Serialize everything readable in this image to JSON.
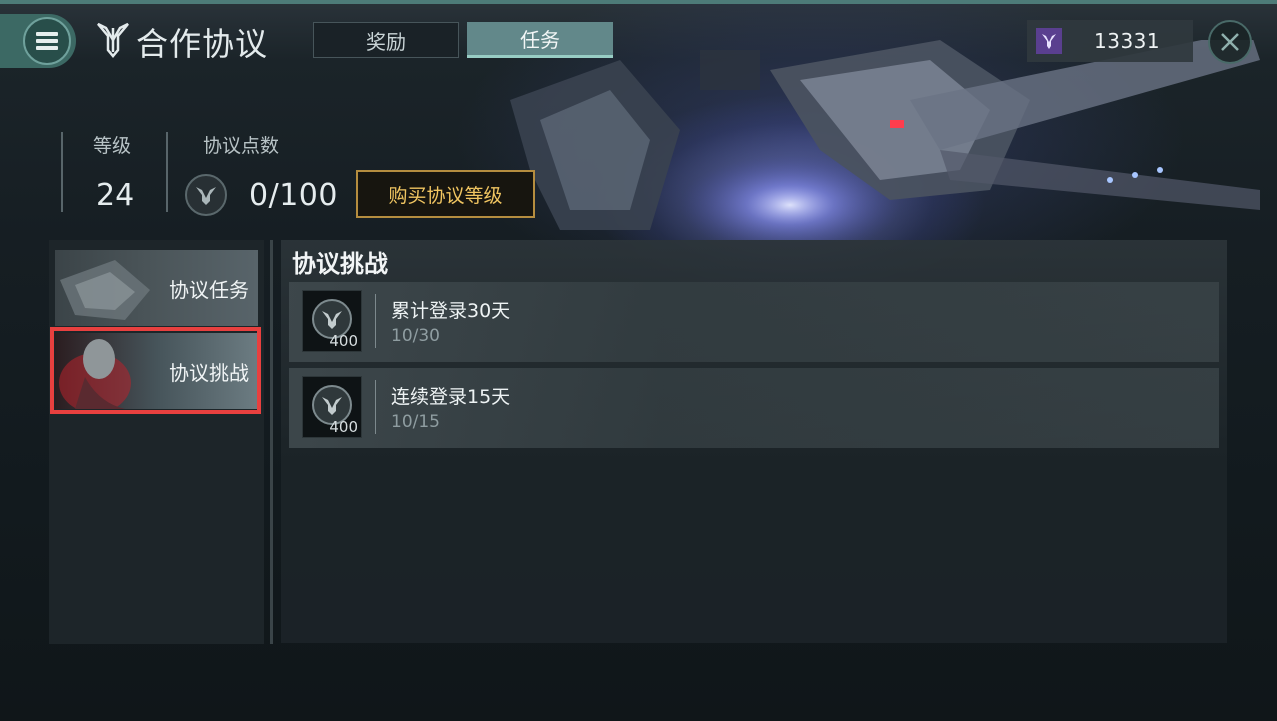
{
  "header": {
    "title": "合作协议",
    "tabs": [
      {
        "label": "奖励",
        "active": false
      },
      {
        "label": "任务",
        "active": true
      }
    ],
    "currency": {
      "icon": "trident-emblem-icon",
      "value": "13331",
      "color": "#5a3f8f"
    }
  },
  "level_info": {
    "level_label": "等级",
    "level_value": "24",
    "points_label": "协议点数",
    "points_value": "0/100",
    "buy_button": "购买协议等级"
  },
  "sidebar": {
    "items": [
      {
        "label": "协议任务",
        "selected": false
      },
      {
        "label": "协议挑战",
        "selected": true
      }
    ]
  },
  "main": {
    "section_title": "协议挑战",
    "tasks": [
      {
        "name": "累计登录30天",
        "progress": "10/30",
        "reward": "400",
        "reward_icon": "protocol-point-icon"
      },
      {
        "name": "连续登录15天",
        "progress": "10/15",
        "reward": "400",
        "reward_icon": "protocol-point-icon"
      }
    ]
  },
  "colors": {
    "accent": "#3c6964",
    "gold": "#f0c561",
    "selection": "#e8403f"
  }
}
